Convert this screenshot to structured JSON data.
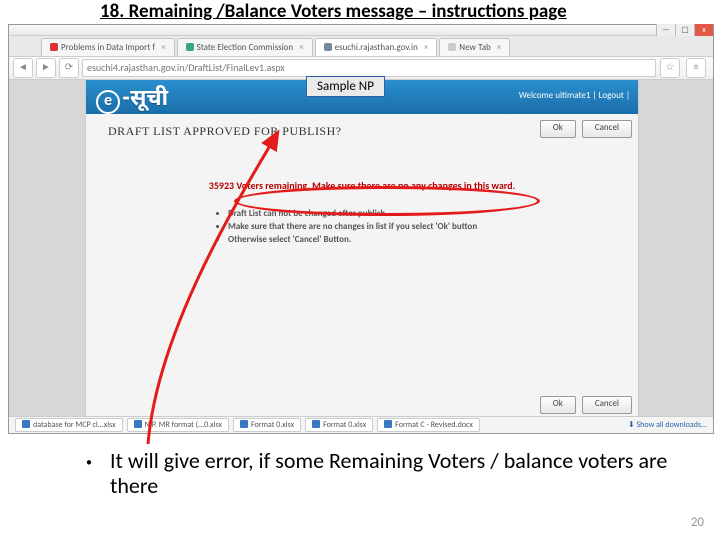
{
  "title": "18.   Remaining /Balance Voters message – instructions page",
  "sample_label": "Sample NP",
  "chrome": {
    "url": "esuchi4.rajasthan.gov.in/DraftList/FinalLev1.aspx",
    "tabs": [
      {
        "label": "Problems in Data Import f",
        "color": "#d33"
      },
      {
        "label": "State Election Commission",
        "color": "#3a7"
      },
      {
        "label": "esuchi.rajasthan.gov.in",
        "color": "#789",
        "active": true
      },
      {
        "label": "New Tab",
        "color": "#ccc"
      }
    ],
    "win": {
      "min": "—",
      "max": "▢",
      "close": "x"
    }
  },
  "app": {
    "logo_e": "e",
    "logo_hi": "-सूची",
    "welcome": "Welcome ultimate1 | Logout |",
    "page_title": "DRAFT LIST APPROVED FOR PUBLISH?",
    "warn": "35923 Voters remaining. Make sure there are no any changes in this ward.",
    "bullets": [
      "Draft List can not be changed after publish.",
      "Make sure that there are no changes in list if you select 'Ok' button",
      "Otherwise select 'Cancel' Button."
    ],
    "ok": "Ok",
    "cancel": "Cancel"
  },
  "downloads": {
    "items": [
      "database for MCP cl...xlsx",
      "N.P. MR format (...0.xlsx",
      "Format 0.xlsx",
      "Format 0.xlsx",
      "Format C - Revised.docx"
    ],
    "showall": "Show all downloads..."
  },
  "caption": "It will give error, if some Remaining Voters / balance voters are there",
  "page_number": "20"
}
